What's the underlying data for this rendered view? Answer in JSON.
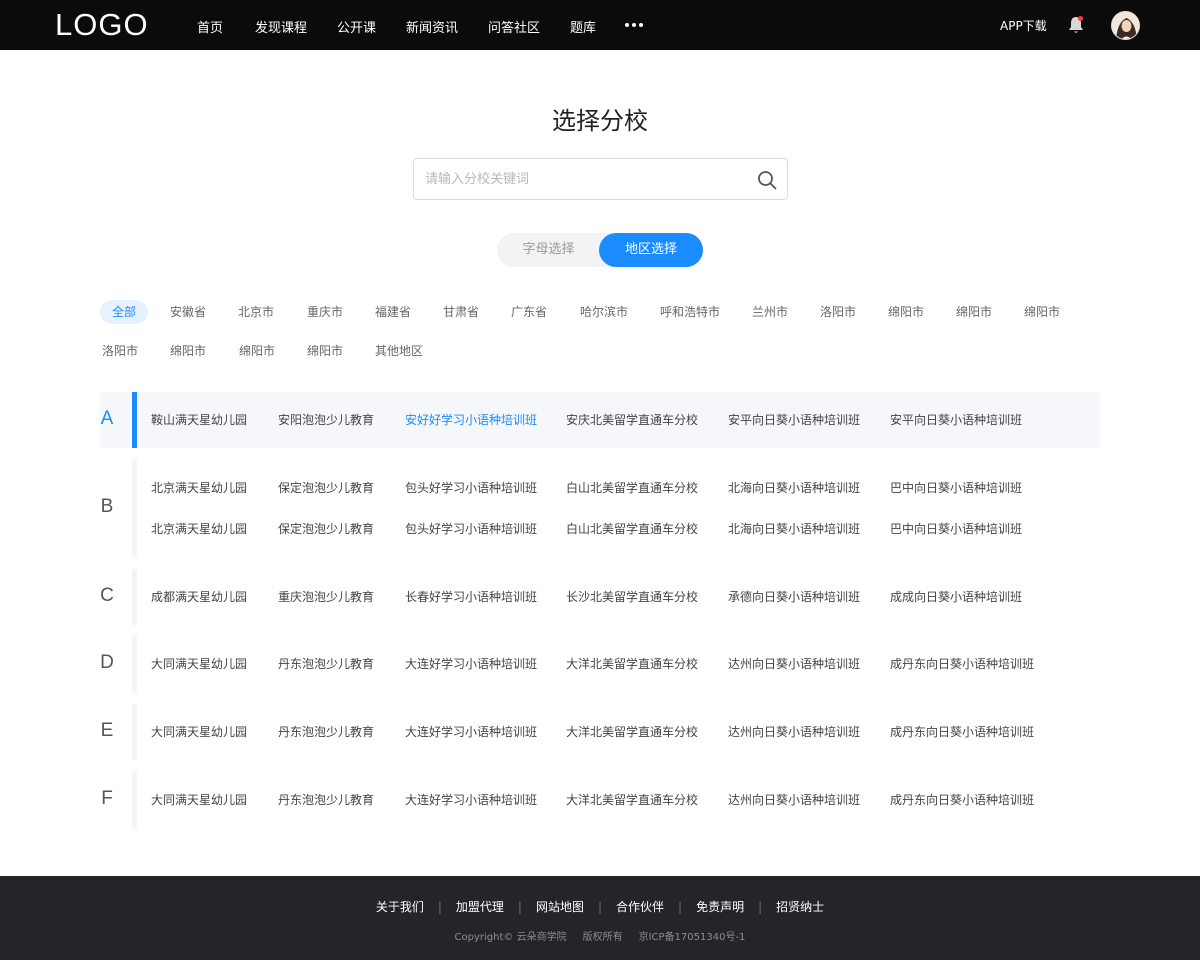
{
  "header": {
    "logo": "LOGO",
    "nav": [
      "首页",
      "发现课程",
      "公开课",
      "新闻资讯",
      "问答社区",
      "题库"
    ],
    "app_download": "APP下载"
  },
  "page": {
    "title": "选择分校",
    "search_placeholder": "请输入分校关键词",
    "tabs": {
      "letter": "字母选择",
      "region": "地区选择",
      "active": "region"
    }
  },
  "regions": [
    "全部",
    "安徽省",
    "北京市",
    "重庆市",
    "福建省",
    "甘肃省",
    "广东省",
    "哈尔滨市",
    "呼和浩特市",
    "兰州市",
    "洛阳市",
    "绵阳市",
    "绵阳市",
    "绵阳市",
    "洛阳市",
    "绵阳市",
    "绵阳市",
    "绵阳市",
    "其他地区"
  ],
  "active_region": "全部",
  "groups": [
    {
      "letter": "A",
      "active": true,
      "rows": [
        [
          "鞍山满天星幼儿园",
          "安阳泡泡少儿教育",
          "安好好学习小语种培训班",
          "安庆北美留学直通车分校",
          "安平向日葵小语种培训班",
          "安平向日葵小语种培训班"
        ]
      ],
      "highlight": "安好好学习小语种培训班"
    },
    {
      "letter": "B",
      "rows": [
        [
          "北京满天星幼儿园",
          "保定泡泡少儿教育",
          "包头好学习小语种培训班",
          "白山北美留学直通车分校",
          "北海向日葵小语种培训班",
          "巴中向日葵小语种培训班"
        ],
        [
          "北京满天星幼儿园",
          "保定泡泡少儿教育",
          "包头好学习小语种培训班",
          "白山北美留学直通车分校",
          "北海向日葵小语种培训班",
          "巴中向日葵小语种培训班"
        ]
      ]
    },
    {
      "letter": "C",
      "rows": [
        [
          "成都满天星幼儿园",
          "重庆泡泡少儿教育",
          "长春好学习小语种培训班",
          "长沙北美留学直通车分校",
          "承德向日葵小语种培训班",
          "成成向日葵小语种培训班"
        ]
      ]
    },
    {
      "letter": "D",
      "rows": [
        [
          "大同满天星幼儿园",
          "丹东泡泡少儿教育",
          "大连好学习小语种培训班",
          "大洋北美留学直通车分校",
          "达州向日葵小语种培训班",
          "成丹东向日葵小语种培训班"
        ]
      ]
    },
    {
      "letter": "E",
      "rows": [
        [
          "大同满天星幼儿园",
          "丹东泡泡少儿教育",
          "大连好学习小语种培训班",
          "大洋北美留学直通车分校",
          "达州向日葵小语种培训班",
          "成丹东向日葵小语种培训班"
        ]
      ]
    },
    {
      "letter": "F",
      "rows": [
        [
          "大同满天星幼儿园",
          "丹东泡泡少儿教育",
          "大连好学习小语种培训班",
          "大洋北美留学直通车分校",
          "达州向日葵小语种培训班",
          "成丹东向日葵小语种培训班"
        ]
      ]
    }
  ],
  "footer": {
    "links": [
      "关于我们",
      "加盟代理",
      "网站地图",
      "合作伙伴",
      "免责声明",
      "招贤纳士"
    ],
    "copyright": [
      "Copyright© 云朵商学院",
      "版权所有",
      "京ICP备17051340号-1"
    ]
  },
  "colors": {
    "accent": "#1a8cff",
    "topbar": "#0b0b0b",
    "footer": "#24252a"
  }
}
